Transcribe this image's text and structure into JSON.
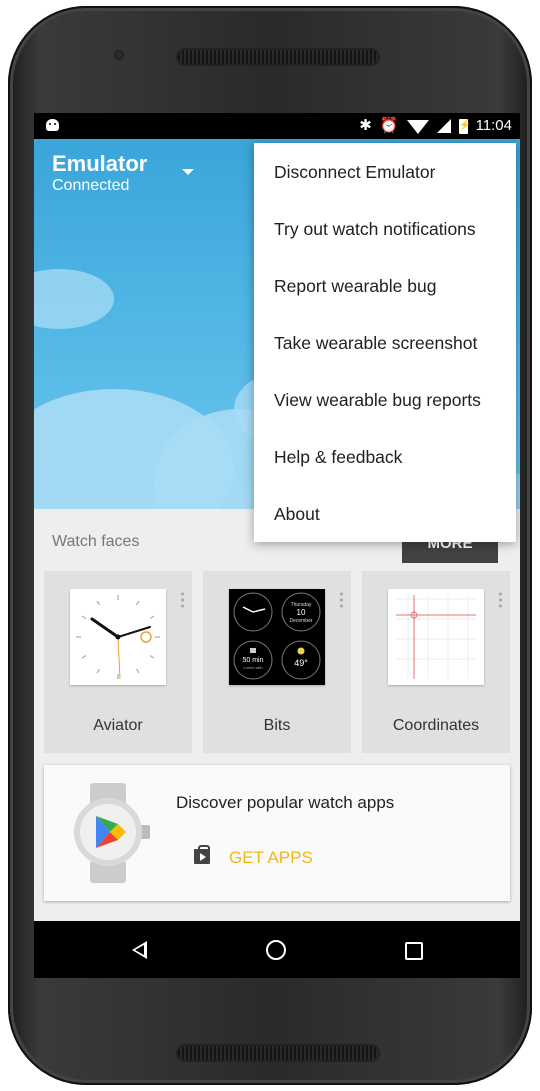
{
  "status_bar": {
    "time": "11:04",
    "icons": [
      "android-icon",
      "bluetooth-icon",
      "alarm-icon",
      "wifi-icon",
      "signal-icon",
      "battery-icon"
    ]
  },
  "device": {
    "name": "Emulator",
    "status": "Connected"
  },
  "overflow_menu": {
    "items": [
      "Disconnect Emulator",
      "Try out watch notifications",
      "Report wearable bug",
      "Take wearable screenshot",
      "View wearable bug reports",
      "Help & feedback",
      "About"
    ]
  },
  "watch_faces": {
    "title": "Watch faces",
    "more_label": "MORE",
    "items": [
      {
        "label": "Aviator"
      },
      {
        "label": "Bits",
        "thursday": "Thursday",
        "date": "10",
        "month": "December",
        "timer": "50 min",
        "lunch": "Lunch with",
        "temp": "49°"
      },
      {
        "label": "Coordinates"
      }
    ]
  },
  "apps_card": {
    "title": "Discover popular watch apps",
    "link_label": "GET APPS"
  },
  "colors": {
    "accent": "#f3b51c",
    "hero_blue": "#4fb5e4",
    "aviator_orange": "#e8a23a",
    "coordinates_red": "#e57373"
  }
}
